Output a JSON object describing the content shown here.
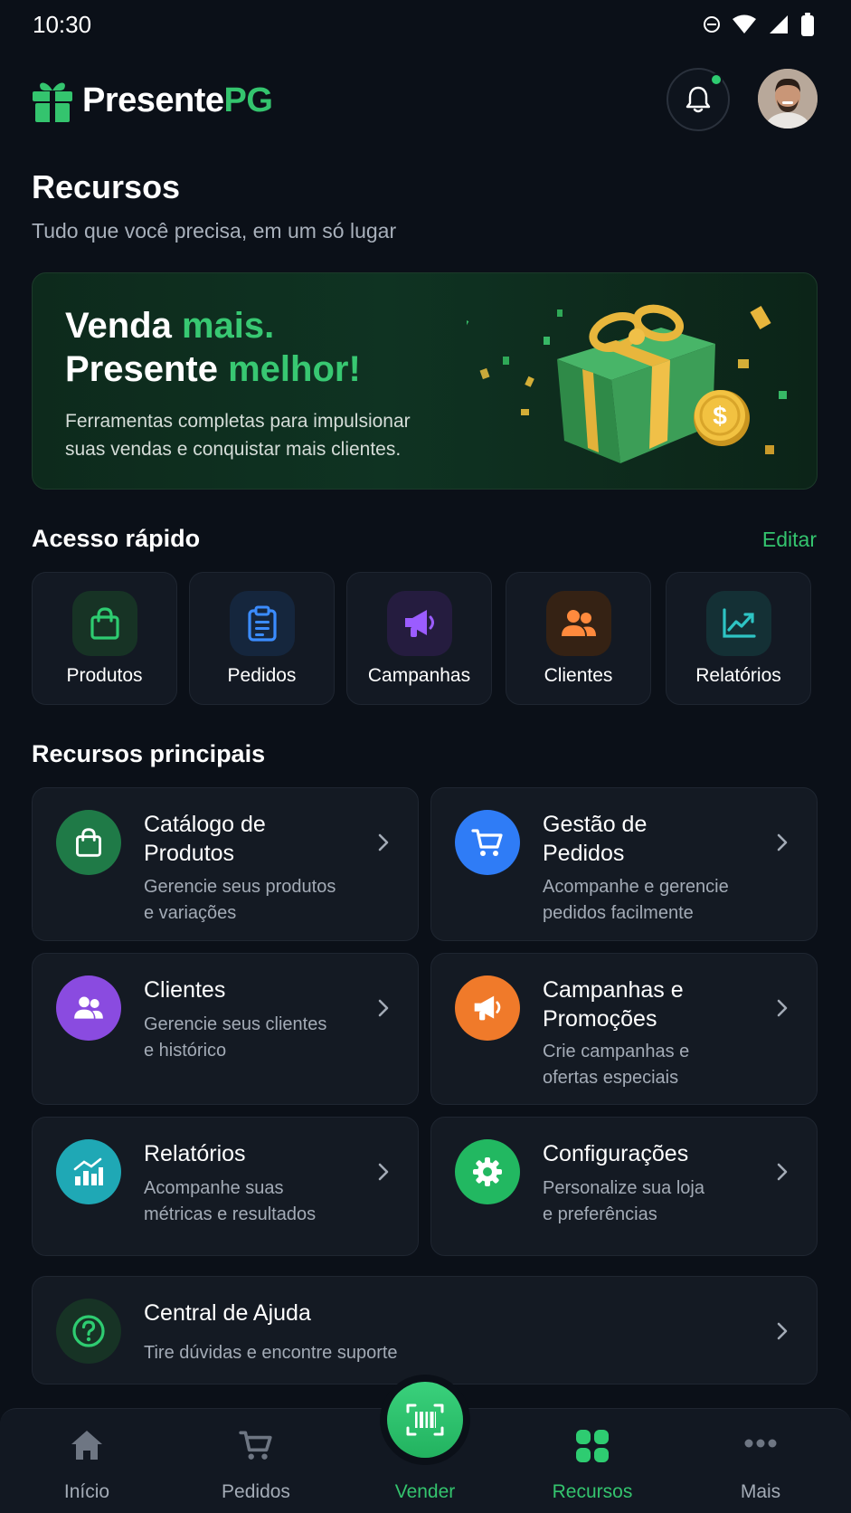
{
  "status_bar": {
    "time": "10:30"
  },
  "header": {
    "brand_main": "Presente",
    "brand_accent": "PG",
    "notification_indicator": true
  },
  "page": {
    "title": "Recursos",
    "subtitle": "Tudo que você precisa, em um só lugar"
  },
  "banner": {
    "line1_white": "Venda ",
    "line1_green": "mais.",
    "line2_white": "Presente ",
    "line2_green": "melhor!",
    "description": "Ferramentas completas para impulsionar suas vendas e conquistar mais clientes."
  },
  "quick_access": {
    "title": "Acesso rápido",
    "edit_label": "Editar",
    "items": [
      {
        "label": "Produtos",
        "icon": "shopping-bag-icon",
        "color": "#2ecc71"
      },
      {
        "label": "Pedidos",
        "icon": "clipboard-icon",
        "color": "#3b8cff"
      },
      {
        "label": "Campanhas",
        "icon": "megaphone-icon",
        "color": "#9b5cff"
      },
      {
        "label": "Clientes",
        "icon": "users-icon",
        "color": "#ff8a3d"
      },
      {
        "label": "Relatórios",
        "icon": "chart-line-icon",
        "color": "#2ec4c4"
      }
    ]
  },
  "main_resources": {
    "title": "Recursos principais",
    "items": [
      {
        "title": "Catálogo de Produtos",
        "title_l1": "Catálogo de",
        "title_l2": "Produtos",
        "desc_l1": "Gerencie seus produtos",
        "desc_l2": "e variações",
        "icon": "shopping-bag-icon",
        "color": "#1f7a47"
      },
      {
        "title": "Gestão de Pedidos",
        "title_l1": "Gestão de",
        "title_l2": "Pedidos",
        "desc_l1": "Acompanhe e gerencie",
        "desc_l2": "pedidos facilmente",
        "icon": "cart-icon",
        "color": "#2f7cf6"
      },
      {
        "title": "Clientes",
        "title_l1": "Clientes",
        "desc_l1": "Gerencie seus clientes",
        "desc_l2": "e histórico",
        "icon": "users-icon",
        "color": "#8a4be0"
      },
      {
        "title": "Campanhas e Promoções",
        "title_l1": "Campanhas e",
        "title_l2": "Promoções",
        "desc_l1": "Crie campanhas e",
        "desc_l2": "ofertas especiais",
        "icon": "megaphone-icon",
        "color": "#f07a2a"
      },
      {
        "title": "Relatórios",
        "title_l1": "Relatórios",
        "desc_l1": "Acompanhe suas",
        "desc_l2": "métricas e resultados",
        "icon": "bar-chart-icon",
        "color": "#1fa8b5"
      },
      {
        "title": "Configurações",
        "title_l1": "Configurações",
        "desc_l1": "Personalize sua loja",
        "desc_l2": "e preferências",
        "icon": "gear-icon",
        "color": "#22b861"
      }
    ]
  },
  "help": {
    "title": "Central de Ajuda",
    "desc": "Tire dúvidas e encontre suporte"
  },
  "bottom_nav": {
    "items": [
      {
        "label": "Início",
        "icon": "home-icon"
      },
      {
        "label": "Pedidos",
        "icon": "cart-icon"
      },
      {
        "label": "Vender",
        "icon": "barcode-scan-icon"
      },
      {
        "label": "Recursos",
        "icon": "grid-icon",
        "active": true
      },
      {
        "label": "Mais",
        "icon": "more-icon"
      }
    ]
  }
}
